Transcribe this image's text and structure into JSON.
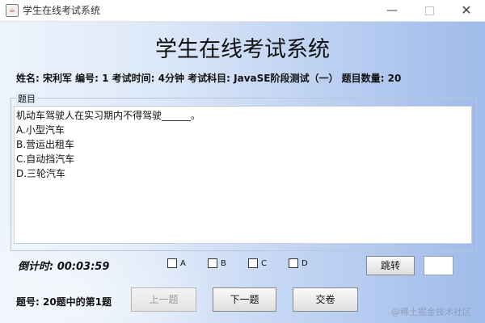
{
  "window": {
    "title": "学生在线考试系统",
    "controls": {
      "minimize": "—",
      "close": "✕"
    }
  },
  "header": {
    "title": "学生在线考试系统",
    "info": "姓名: 宋利军 编号: 1 考试时间: 4分钟 考试科目: JavaSE阶段测试（一） 题目数量: 20"
  },
  "question": {
    "group_label": "题目",
    "text": "机动车驾驶人在实习期内不得驾驶______。",
    "options": [
      "A.小型汽车",
      "B.营运出租车",
      "C.自动挡汽车",
      "D.三轮汽车"
    ]
  },
  "answer": {
    "countdown": "倒计时: 00:03:59",
    "choices": [
      "A",
      "B",
      "C",
      "D"
    ]
  },
  "buttons": {
    "jump": "跳转",
    "prev": "上一题",
    "next": "下一题",
    "submit": "交卷"
  },
  "jump_input_value": "",
  "footer": {
    "progress": "题号: 20题中的第1题",
    "watermark": "@稀土掘金技术社区"
  }
}
